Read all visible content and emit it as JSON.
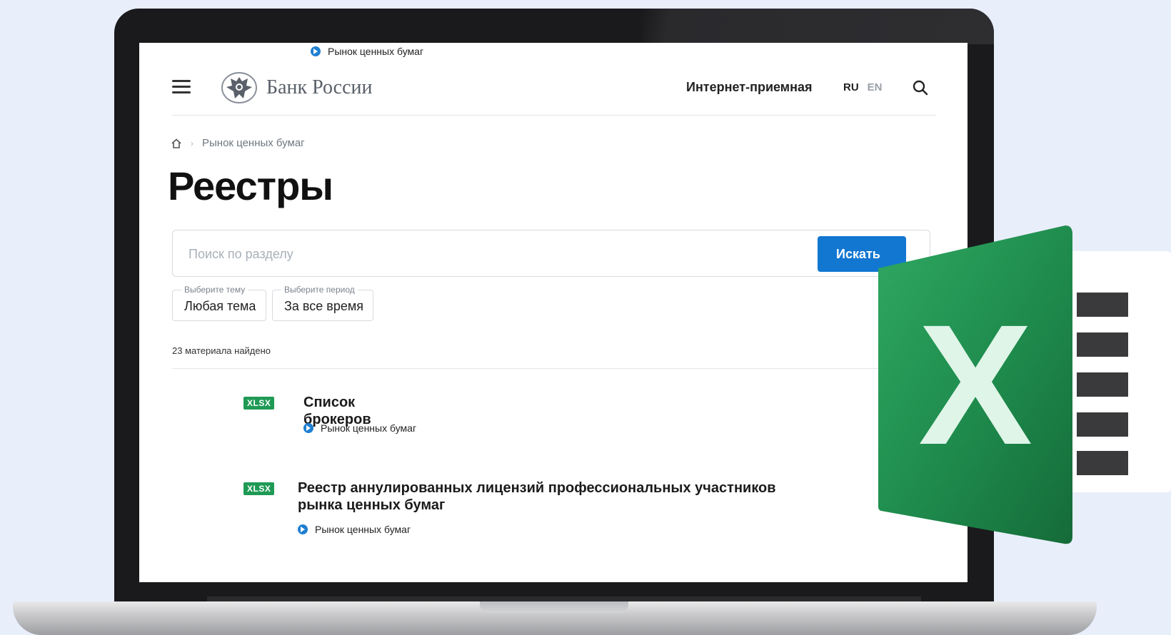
{
  "top_crumb": {
    "label": "Рынок ценных бумаг"
  },
  "header": {
    "logo_text": "Банк России",
    "reception_label": "Интернет-приемная",
    "lang_ru": "RU",
    "lang_en": "EN"
  },
  "breadcrumb": {
    "items": [
      "Рынок ценных бумаг"
    ]
  },
  "page_title": "Реестры",
  "search": {
    "placeholder": "Поиск по разделу",
    "button_label": "Искать"
  },
  "filters": [
    {
      "label": "Выберите тему",
      "value": "Любая тема"
    },
    {
      "label": "Выберите период",
      "value": "За все время"
    }
  ],
  "results_count": "23 материала найдено",
  "documents": [
    {
      "badge": "XLSX",
      "title": "Список брокеров",
      "tag": "Рынок ценных бумаг"
    },
    {
      "badge": "XLSX",
      "title": "Реестр аннулированных лицензий профессиональных участников рынка ценных бумаг",
      "tag": "Рынок ценных бумаг"
    }
  ],
  "excel_icon": {
    "letter": "X"
  },
  "colors": {
    "accent_blue": "#1277d1",
    "badge_green": "#1f9a55",
    "excel_green": "#1e7e45"
  }
}
